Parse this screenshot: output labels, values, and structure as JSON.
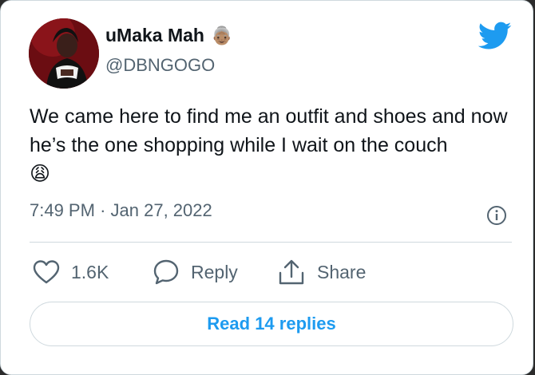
{
  "author": {
    "name": "uMaka Mah",
    "name_emoji": "👵🏽",
    "handle": "@DBNGOGO",
    "avatar_icon": "profile-photo"
  },
  "tweet": {
    "text": "We came here to find me an outfit and shoes and now he’s the one shopping while I wait on the couch",
    "emoji": "😩",
    "time": "7:49 PM",
    "separator": "·",
    "date": "Jan 27, 2022"
  },
  "actions": {
    "like_count": "1.6K",
    "reply_label": "Reply",
    "share_label": "Share"
  },
  "read_replies_label": "Read 14 replies",
  "colors": {
    "brand": "#1d9bf0",
    "text": "#0f1419",
    "secondary": "#536471",
    "border": "#cfd9de"
  },
  "icons": [
    "twitter-bird-icon",
    "info-icon",
    "heart-icon",
    "reply-bubble-icon",
    "share-icon"
  ]
}
